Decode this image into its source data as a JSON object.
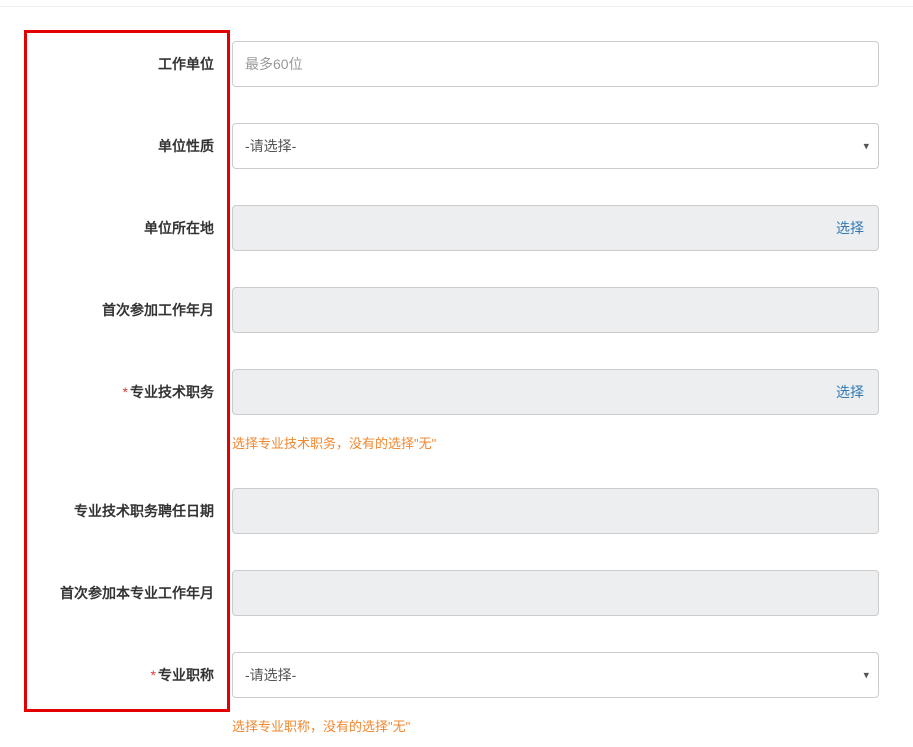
{
  "form": {
    "work_unit": {
      "label": "工作单位",
      "placeholder": "最多60位"
    },
    "unit_nature": {
      "label": "单位性质",
      "placeholder": "-请选择-"
    },
    "unit_location": {
      "label": "单位所在地",
      "select_text": "选择"
    },
    "first_work_date": {
      "label": "首次参加工作年月"
    },
    "pro_tech_position": {
      "label": "专业技术职务",
      "select_text": "选择",
      "help": "选择专业技术职务，没有的选择\"无\""
    },
    "pro_tech_position_date": {
      "label": "专业技术职务聘任日期"
    },
    "first_major_work_date": {
      "label": "首次参加本专业工作年月"
    },
    "pro_title": {
      "label": "专业职称",
      "placeholder": "-请选择-",
      "help": "选择专业职称，没有的选择\"无\""
    },
    "required_mark": "*"
  }
}
